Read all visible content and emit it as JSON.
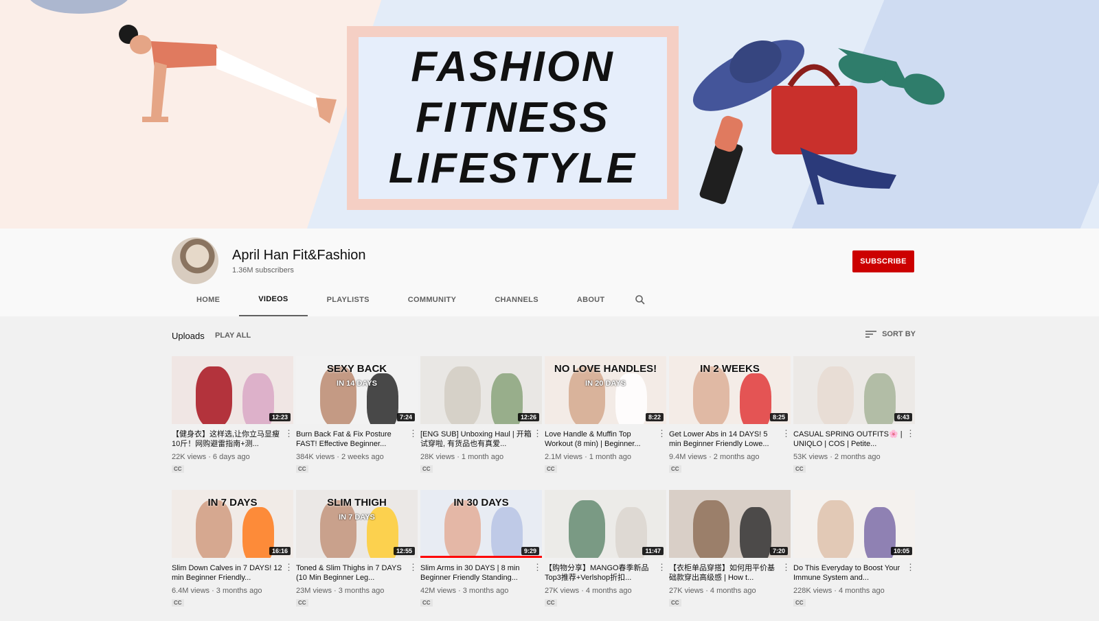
{
  "banner": {
    "lines": [
      "FASHION",
      "FITNESS",
      "LIFESTYLE"
    ]
  },
  "channel": {
    "name": "April Han Fit&Fashion",
    "subscribers": "1.36M subscribers",
    "subscribe_label": "SUBSCRIBE"
  },
  "tabs": [
    {
      "label": "HOME"
    },
    {
      "label": "VIDEOS"
    },
    {
      "label": "PLAYLISTS"
    },
    {
      "label": "COMMUNITY"
    },
    {
      "label": "CHANNELS"
    },
    {
      "label": "ABOUT"
    }
  ],
  "uploads": {
    "title": "Uploads",
    "play_all": "PLAY ALL",
    "sort_by": "SORT BY"
  },
  "videos": [
    {
      "title": "【健身衣】这样选,让你立马显瘦10斤！网购避雷指南+测...",
      "meta": "22K views · 6 days ago",
      "duration": "12:23",
      "cc": "CC",
      "overlay": "",
      "overlay2": "",
      "colors": [
        "#f0e6e4",
        "#b3333c",
        "#d9a7c6"
      ]
    },
    {
      "title": "Burn Back Fat & Fix Posture FAST! Effective Beginner...",
      "meta": "384K views · 2 weeks ago",
      "duration": "7:24",
      "cc": "CC",
      "overlay": "SEXY BACK",
      "overlay2": "IN 14 DAYS",
      "colors": [
        "#f2f2f2",
        "#c49a84",
        "#2a2a2a"
      ]
    },
    {
      "title": "[ENG SUB] Unboxing Haul | 开箱试穿啦, 有货品也有真爱...",
      "meta": "28K views · 1 month ago",
      "duration": "12:26",
      "cc": "CC",
      "overlay": "",
      "overlay2": "",
      "colors": [
        "#e9e7e4",
        "#d6d1c8",
        "#8aa37b"
      ]
    },
    {
      "title": "Love Handle & Muffin Top Workout (8 min) | Beginner...",
      "meta": "2.1M views · 1 month ago",
      "duration": "8:22",
      "cc": "CC",
      "overlay": "NO LOVE HANDLES!",
      "overlay2": "IN 20 DAYS",
      "colors": [
        "#f3ebe6",
        "#d9b39b",
        "#ffffff"
      ]
    },
    {
      "title": "Get Lower Abs in 14 DAYS! 5 min Beginner Friendly Lowe...",
      "meta": "9.4M views · 2 months ago",
      "duration": "8:25",
      "cc": "CC",
      "overlay": "IN 2 WEEKS",
      "overlay2": "",
      "colors": [
        "#f4ece7",
        "#e0b9a4",
        "#e03a3a"
      ]
    },
    {
      "title": "CASUAL SPRING OUTFITS🌸 | UNIQLO | COS | Petite...",
      "meta": "53K views · 2 months ago",
      "duration": "6:43",
      "cc": "CC",
      "overlay": "",
      "overlay2": "",
      "colors": [
        "#ece9e6",
        "#e8ddd5",
        "#a8b59a"
      ]
    },
    {
      "title": "Slim Down Calves in 7 DAYS! 12 min Beginner Friendly...",
      "meta": "6.4M views · 3 months ago",
      "duration": "16:16",
      "cc": "CC",
      "overlay": "IN 7 DAYS",
      "overlay2": "",
      "colors": [
        "#f1ebe7",
        "#d6a890",
        "#ff7a1a"
      ]
    },
    {
      "title": "Toned & Slim Thighs in 7 DAYS (10 Min Beginner Leg...",
      "meta": "23M views · 3 months ago",
      "duration": "12:55",
      "cc": "CC",
      "overlay": "SLIM THIGH",
      "overlay2": "IN 7 DAYS",
      "colors": [
        "#ebe8e6",
        "#c9a18c",
        "#ffcc33"
      ]
    },
    {
      "title": "Slim Arms in 30 DAYS | 8 min Beginner Friendly Standing...",
      "meta": "42M views · 3 months ago",
      "duration": "9:29",
      "cc": "CC",
      "overlay": "IN 30 DAYS",
      "overlay2": "",
      "colors": [
        "#e8ecf3",
        "#e4b7a6",
        "#b7c4e4"
      ],
      "progress": 1.0
    },
    {
      "title": "【购物分享】MANGO春季新品Top3推荐+Verlshop折扣...",
      "meta": "27K views · 4 months ago",
      "duration": "11:47",
      "cc": "CC",
      "overlay": "",
      "overlay2": "",
      "colors": [
        "#ecebe8",
        "#7a9a84",
        "#dcd6cf"
      ]
    },
    {
      "title": "【衣柜单品穿搭】如何用平价基础款穿出高级感 | How t...",
      "meta": "27K views · 4 months ago",
      "duration": "7:20",
      "cc": "CC",
      "overlay": "",
      "overlay2": "",
      "colors": [
        "#d9cfc7",
        "#9b7f6a",
        "#333333"
      ]
    },
    {
      "title": "Do This Everyday to Boost Your Immune System and...",
      "meta": "228K views · 4 months ago",
      "duration": "10:05",
      "cc": "CC",
      "overlay": "",
      "overlay2": "",
      "colors": [
        "#f4f1ee",
        "#e2c9b6",
        "#7d6da8"
      ]
    }
  ]
}
